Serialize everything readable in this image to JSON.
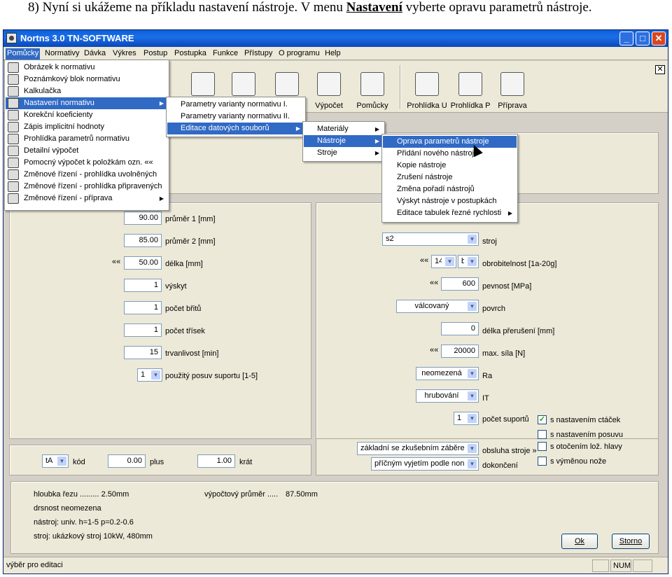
{
  "caption": {
    "prefix": "8)    Nyní si ukážeme na příkladu nastavení nástroje. V menu ",
    "emph": "Nastavení",
    "suffix": " vyberte opravu parametrů nástroje."
  },
  "window": {
    "title": "Nortns 3.0 TN-SOFTWARE",
    "min_glyph": "_",
    "max_glyph": "□",
    "close_glyph": "✕",
    "doc_close_glyph": "✕"
  },
  "menubar": [
    "Pomůcky",
    "Normativy",
    "Dávka",
    "Výkres",
    "Postup",
    "Postupka",
    "Funkce",
    "Přístupy",
    "O programu",
    "Help"
  ],
  "toolbar": [
    {
      "label": "",
      "icon": "chart-icon"
    },
    {
      "label": "",
      "icon": "paperclip-icon"
    },
    {
      "label": "",
      "icon": "tools-icon"
    },
    {
      "label": "Výpočet",
      "icon": "calculation-icon"
    },
    {
      "label": "Pomůcky",
      "icon": "calculator-icon"
    },
    {
      "label": "Prohlídka U",
      "icon": "inspection-u-icon"
    },
    {
      "label": "Prohlídka P",
      "icon": "inspection-p-icon"
    },
    {
      "label": "Příprava",
      "icon": "preparation-icon"
    }
  ],
  "menu_main": [
    "Obrázek k normativu",
    "Poznámkový blok normativu",
    "Kalkulačka",
    "Nastavení normativu",
    "Korekční koeficienty",
    "Zápis implicitní hodnoty",
    "Prohlídka parametrů normativu",
    "Detailní výpočet",
    "Pomocný výpočet k položkám ozn. «« ",
    "Změnové řízení - prohlídka uvolněných",
    "Změnové řízení - prohlídka připravených",
    "Změnové řízení - příprava"
  ],
  "menu_nastaveni": [
    "Parametry varianty normativu I.",
    "Parametry varianty normativu II.",
    "Editace datových souborů"
  ],
  "menu_editace": [
    "Materiály",
    "Nástroje",
    "Stroje"
  ],
  "menu_nastroje": [
    "Oprava parametrů nástroje",
    "Přidání nového nástroje",
    "Kopie nástroje",
    "Zrušení nástroje",
    "Změna pořadí nástrojů",
    "Výskyt nástroje v postupkách",
    "Editace tabulek řezné rychlosti"
  ],
  "submenu_arrow": "▶",
  "combo_arrow": "▼",
  "left_form": {
    "d1": {
      "value": "90.00",
      "label": "průměr 1 [mm]"
    },
    "d2": {
      "value": "85.00",
      "label": "průměr 2 [mm]"
    },
    "len": {
      "value": "50.00",
      "label": "délka [mm]",
      "marker": "««"
    },
    "occ": {
      "value": "1",
      "label": "výskyt"
    },
    "edges": {
      "value": "1",
      "label": "počet břitů"
    },
    "chips": {
      "value": "1",
      "label": "počet třísek"
    },
    "life": {
      "value": "15",
      "label": "trvanlivost [min]"
    },
    "feed": {
      "value": "1",
      "label": "použitý posuv suportu [1-5]"
    }
  },
  "right_form": {
    "machine": {
      "value": "s2",
      "label": "stroj"
    },
    "machin": {
      "marker": "««",
      "v1": "14",
      "v2": "b",
      "label": "obrobitelnost [1a-20g]"
    },
    "strength": {
      "marker": "««",
      "value": "600",
      "label": "pevnost [MPa]"
    },
    "surface": {
      "value": "válcovaný",
      "label": "povrch"
    },
    "interrupt": {
      "value": "0",
      "label": "délka přerušení [mm]"
    },
    "force": {
      "marker": "««",
      "value": "20000",
      "label": "max. síla [N]"
    },
    "ra": {
      "value": "neomezená",
      "label": "Ra"
    },
    "it": {
      "value": "hrubování",
      "label": "IT"
    },
    "supports": {
      "value": "1",
      "label": "počet suportů"
    },
    "operate": {
      "value": "základní se zkušebním záběrem",
      "label": "obsluha stroje »"
    },
    "finish": {
      "value": "příčným vyjetím podle nonia",
      "label": "dokončení"
    }
  },
  "checks": [
    {
      "label": "s nastavením ctáček",
      "checked": "✓"
    },
    {
      "label": "s nastavením posuvu",
      "checked": ""
    },
    {
      "label": "s otočením lož. hlavy",
      "checked": ""
    },
    {
      "label": "s výměnou nože",
      "checked": ""
    }
  ],
  "code_row": {
    "code": "tA",
    "code_label": "kód",
    "plus_value": "0.00",
    "plus_label": "plus",
    "times_value": "1.00",
    "times_label": "krát"
  },
  "info": {
    "depth": "hloubka řezu ......... 2.50mm",
    "diam": "výpočtový průměr .....",
    "diam_value": "87.50mm",
    "rough": "drsnost neomezena",
    "tool": "nástroj: univ. h=1-5 p=0.2-0.6",
    "machine": "stroj: ukázkový stroj 10kW, 480mm"
  },
  "buttons": {
    "ok": "Ok",
    "cancel": "Storno"
  },
  "status": {
    "text": "výběr pro editaci",
    "num": "NUM"
  }
}
